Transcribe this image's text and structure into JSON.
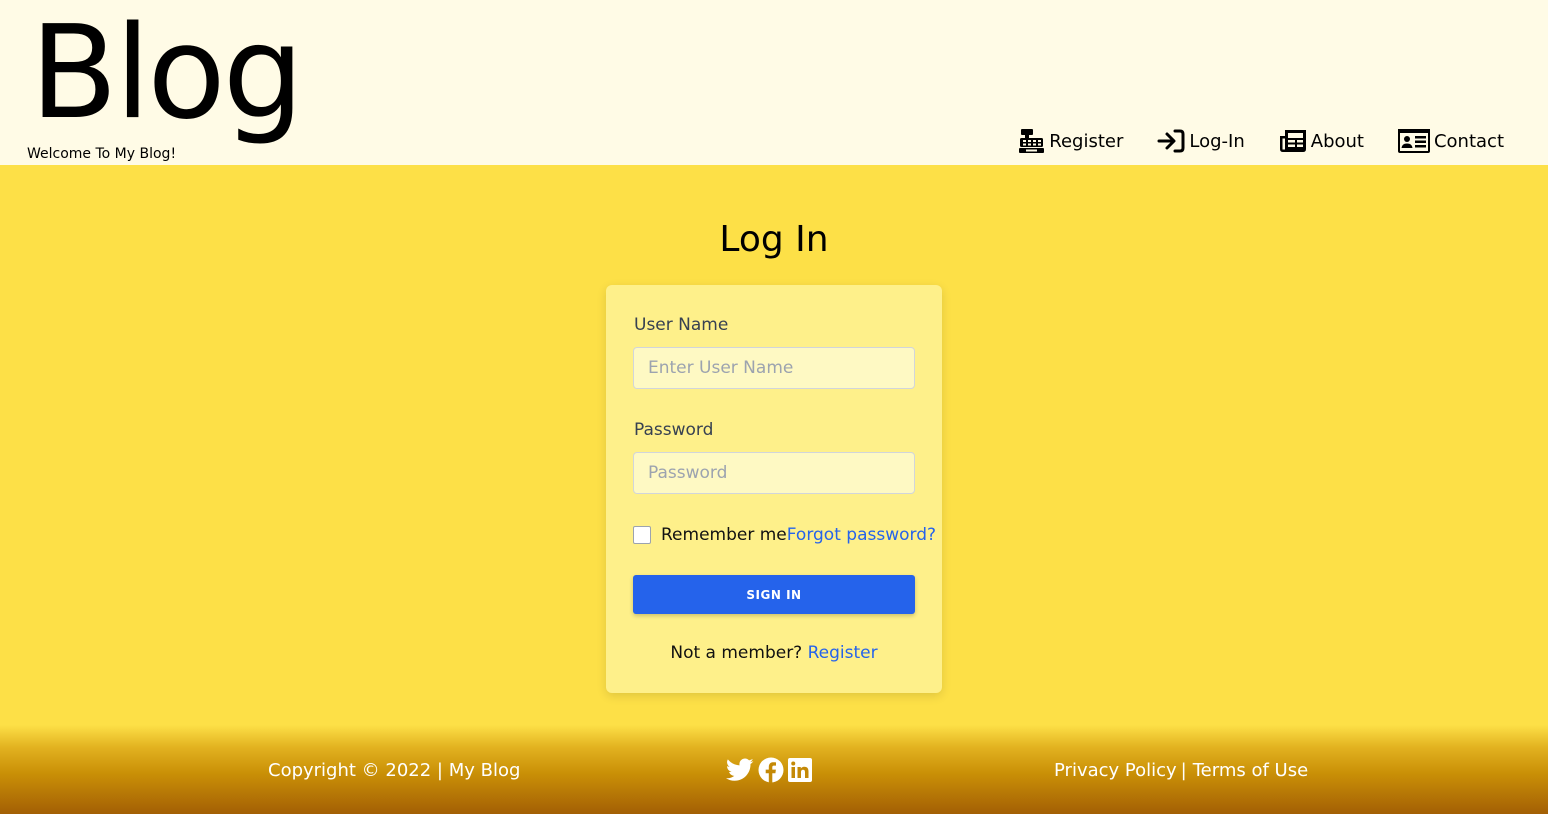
{
  "header": {
    "brand": "Blog",
    "tagline": "Welcome To My Blog!",
    "nav": [
      {
        "label": "Register",
        "icon": "cash-register-icon"
      },
      {
        "label": "Log-In",
        "icon": "sign-in-icon"
      },
      {
        "label": "About",
        "icon": "newspaper-icon"
      },
      {
        "label": "Contact",
        "icon": "address-card-icon"
      }
    ]
  },
  "main": {
    "title": "Log In",
    "form": {
      "username_label": "User Name",
      "username_placeholder": "Enter User Name",
      "username_value": "",
      "password_label": "Password",
      "password_placeholder": "Password",
      "password_value": "",
      "remember_label": "Remember me",
      "forgot_label": "Forgot password?",
      "signin_label": "SIGN IN",
      "not_member_text": "Not a member?",
      "register_link": "Register"
    }
  },
  "footer": {
    "copyright": "Copyright © 2022 | My Blog",
    "social": [
      "twitter-icon",
      "facebook-icon",
      "linkedin-icon"
    ],
    "privacy": "Privacy Policy",
    "separator": "|",
    "terms": "Terms of Use"
  },
  "colors": {
    "header_bg": "#fffbe6",
    "main_bg": "#fde047",
    "card_bg": "#fef08a",
    "button_bg": "#2563eb",
    "link": "#2563eb",
    "footer_bottom": "#a35f05"
  }
}
